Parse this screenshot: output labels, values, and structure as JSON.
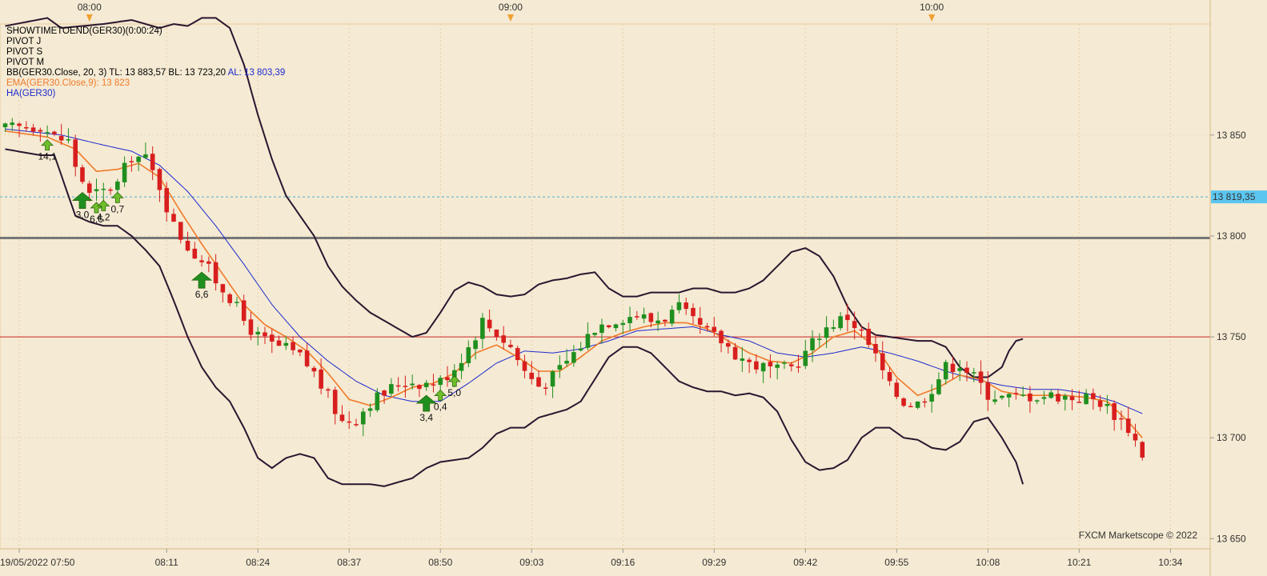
{
  "chart_data": {
    "type": "candlestick",
    "instrument": "GER30",
    "ylim": [
      13645,
      13905
    ],
    "y_ticks": [
      13650,
      13700,
      13750,
      13800,
      13850
    ],
    "y_tick_labels": [
      "13 650",
      "13 700",
      "13 750",
      "13 800",
      "13 850"
    ],
    "current_price": 13819.35,
    "current_price_label": "13 819,35",
    "top_time_labels": [
      {
        "t": 12,
        "label": "08:00"
      },
      {
        "t": 72,
        "label": "09:00"
      },
      {
        "t": 132,
        "label": "10:00"
      }
    ],
    "x_tick_labels": [
      {
        "t": 2,
        "label": "19/05/2022 07:50"
      },
      {
        "t": 23,
        "label": "08:11"
      },
      {
        "t": 36,
        "label": "08:24"
      },
      {
        "t": 49,
        "label": "08:37"
      },
      {
        "t": 62,
        "label": "08:50"
      },
      {
        "t": 75,
        "label": "09:03"
      },
      {
        "t": 88,
        "label": "09:16"
      },
      {
        "t": 101,
        "label": "09:29"
      },
      {
        "t": 114,
        "label": "09:42"
      },
      {
        "t": 127,
        "label": "09:55"
      },
      {
        "t": 140,
        "label": "10:08"
      },
      {
        "t": 153,
        "label": "10:21"
      },
      {
        "t": 166,
        "label": "10:34"
      }
    ],
    "horizontal_lines": [
      {
        "name": "pivot-gray",
        "value": 13799,
        "color": "#777777"
      },
      {
        "name": "pivot-red",
        "value": 13750,
        "color": "#cc2222"
      },
      {
        "name": "current-dotted",
        "value": 13819.35,
        "color": "#4ab0d6"
      }
    ],
    "candle_anchors": [
      [
        0,
        13853
      ],
      [
        3,
        13854
      ],
      [
        5,
        13855
      ],
      [
        7,
        13849
      ],
      [
        9,
        13847
      ],
      [
        10,
        13835
      ],
      [
        12,
        13820
      ],
      [
        14,
        13822
      ],
      [
        16,
        13826
      ],
      [
        18,
        13840
      ],
      [
        20,
        13838
      ],
      [
        22,
        13825
      ],
      [
        24,
        13805
      ],
      [
        26,
        13795
      ],
      [
        28,
        13788
      ],
      [
        30,
        13778
      ],
      [
        32,
        13770
      ],
      [
        34,
        13758
      ],
      [
        36,
        13750
      ],
      [
        38,
        13746
      ],
      [
        40,
        13744
      ],
      [
        42,
        13740
      ],
      [
        44,
        13732
      ],
      [
        46,
        13720
      ],
      [
        48,
        13708
      ],
      [
        50,
        13710
      ],
      [
        52,
        13718
      ],
      [
        54,
        13722
      ],
      [
        56,
        13727
      ],
      [
        58,
        13728
      ],
      [
        60,
        13727
      ],
      [
        62,
        13728
      ],
      [
        64,
        13735
      ],
      [
        66,
        13745
      ],
      [
        68,
        13758
      ],
      [
        70,
        13752
      ],
      [
        72,
        13745
      ],
      [
        74,
        13733
      ],
      [
        76,
        13726
      ],
      [
        78,
        13730
      ],
      [
        80,
        13738
      ],
      [
        82,
        13746
      ],
      [
        84,
        13755
      ],
      [
        86,
        13758
      ],
      [
        88,
        13760
      ],
      [
        90,
        13761
      ],
      [
        92,
        13758
      ],
      [
        94,
        13760
      ],
      [
        96,
        13764
      ],
      [
        98,
        13757
      ],
      [
        100,
        13752
      ],
      [
        102,
        13748
      ],
      [
        104,
        13742
      ],
      [
        106,
        13737
      ],
      [
        108,
        13735
      ],
      [
        110,
        13733
      ],
      [
        112,
        13735
      ],
      [
        114,
        13742
      ],
      [
        116,
        13752
      ],
      [
        118,
        13757
      ],
      [
        120,
        13760
      ],
      [
        122,
        13752
      ],
      [
        124,
        13740
      ],
      [
        126,
        13725
      ],
      [
        128,
        13718
      ],
      [
        130,
        13717
      ],
      [
        132,
        13725
      ],
      [
        134,
        13735
      ],
      [
        136,
        13737
      ],
      [
        138,
        13730
      ],
      [
        140,
        13722
      ],
      [
        142,
        13720
      ],
      [
        144,
        13720
      ],
      [
        146,
        13721
      ],
      [
        148,
        13721
      ],
      [
        150,
        13721
      ],
      [
        152,
        13720
      ],
      [
        154,
        13720
      ],
      [
        156,
        13718
      ],
      [
        158,
        13712
      ],
      [
        160,
        13705
      ],
      [
        162,
        13692
      ]
    ],
    "ema_anchors": [
      [
        0,
        13852
      ],
      [
        6,
        13849
      ],
      [
        10,
        13843
      ],
      [
        13,
        13832
      ],
      [
        16,
        13833
      ],
      [
        19,
        13836
      ],
      [
        22,
        13829
      ],
      [
        25,
        13812
      ],
      [
        28,
        13796
      ],
      [
        31,
        13781
      ],
      [
        34,
        13766
      ],
      [
        37,
        13756
      ],
      [
        40,
        13750
      ],
      [
        43,
        13743
      ],
      [
        46,
        13732
      ],
      [
        49,
        13719
      ],
      [
        52,
        13716
      ],
      [
        55,
        13720
      ],
      [
        58,
        13725
      ],
      [
        61,
        13727
      ],
      [
        64,
        13732
      ],
      [
        67,
        13742
      ],
      [
        70,
        13746
      ],
      [
        73,
        13740
      ],
      [
        76,
        13733
      ],
      [
        79,
        13733
      ],
      [
        82,
        13740
      ],
      [
        85,
        13748
      ],
      [
        88,
        13752
      ],
      [
        91,
        13755
      ],
      [
        94,
        13757
      ],
      [
        97,
        13757
      ],
      [
        100,
        13754
      ],
      [
        103,
        13748
      ],
      [
        106,
        13742
      ],
      [
        109,
        13738
      ],
      [
        112,
        13737
      ],
      [
        115,
        13742
      ],
      [
        118,
        13750
      ],
      [
        121,
        13753
      ],
      [
        124,
        13745
      ],
      [
        127,
        13730
      ],
      [
        130,
        13721
      ],
      [
        133,
        13725
      ],
      [
        136,
        13731
      ],
      [
        139,
        13729
      ],
      [
        142,
        13723
      ],
      [
        145,
        13721
      ],
      [
        148,
        13721
      ],
      [
        151,
        13721
      ],
      [
        154,
        13720
      ],
      [
        157,
        13718
      ],
      [
        160,
        13708
      ],
      [
        162,
        13700
      ]
    ],
    "ha_anchors": [
      [
        0,
        13853
      ],
      [
        8,
        13850
      ],
      [
        14,
        13845
      ],
      [
        18,
        13842
      ],
      [
        22,
        13835
      ],
      [
        26,
        13822
      ],
      [
        30,
        13805
      ],
      [
        34,
        13786
      ],
      [
        38,
        13766
      ],
      [
        42,
        13750
      ],
      [
        46,
        13738
      ],
      [
        50,
        13728
      ],
      [
        54,
        13721
      ],
      [
        58,
        13718
      ],
      [
        62,
        13718
      ],
      [
        66,
        13727
      ],
      [
        70,
        13737
      ],
      [
        74,
        13743
      ],
      [
        78,
        13742
      ],
      [
        82,
        13744
      ],
      [
        86,
        13748
      ],
      [
        90,
        13753
      ],
      [
        94,
        13754
      ],
      [
        98,
        13755
      ],
      [
        102,
        13751
      ],
      [
        106,
        13748
      ],
      [
        110,
        13742
      ],
      [
        114,
        13740
      ],
      [
        118,
        13742
      ],
      [
        122,
        13745
      ],
      [
        126,
        13742
      ],
      [
        130,
        13738
      ],
      [
        134,
        13733
      ],
      [
        138,
        13729
      ],
      [
        142,
        13726
      ],
      [
        146,
        13724
      ],
      [
        150,
        13724
      ],
      [
        154,
        13722
      ],
      [
        158,
        13718
      ],
      [
        162,
        13712
      ]
    ],
    "bb_upper_anchors": [
      [
        0,
        13904
      ],
      [
        6,
        13908
      ],
      [
        8,
        13903
      ],
      [
        14,
        13905
      ],
      [
        18,
        13907
      ],
      [
        20,
        13905
      ],
      [
        22,
        13903
      ],
      [
        24,
        13905
      ],
      [
        26,
        13904
      ],
      [
        28,
        13908
      ],
      [
        30,
        13908
      ],
      [
        32,
        13903
      ],
      [
        34,
        13885
      ],
      [
        36,
        13860
      ],
      [
        38,
        13838
      ],
      [
        40,
        13820
      ],
      [
        42,
        13810
      ],
      [
        44,
        13800
      ],
      [
        46,
        13785
      ],
      [
        48,
        13775
      ],
      [
        50,
        13768
      ],
      [
        52,
        13762
      ],
      [
        54,
        13758
      ],
      [
        56,
        13754
      ],
      [
        58,
        13750
      ],
      [
        60,
        13752
      ],
      [
        62,
        13762
      ],
      [
        64,
        13773
      ],
      [
        66,
        13777
      ],
      [
        68,
        13775
      ],
      [
        70,
        13771
      ],
      [
        72,
        13770
      ],
      [
        74,
        13771
      ],
      [
        76,
        13776
      ],
      [
        78,
        13778
      ],
      [
        80,
        13779
      ],
      [
        82,
        13781
      ],
      [
        84,
        13782
      ],
      [
        86,
        13774
      ],
      [
        88,
        13770
      ],
      [
        90,
        13770
      ],
      [
        92,
        13772
      ],
      [
        94,
        13772
      ],
      [
        96,
        13772
      ],
      [
        98,
        13774
      ],
      [
        100,
        13774
      ],
      [
        102,
        13772
      ],
      [
        104,
        13772
      ],
      [
        106,
        13774
      ],
      [
        108,
        13778
      ],
      [
        110,
        13785
      ],
      [
        112,
        13792
      ],
      [
        114,
        13794
      ],
      [
        116,
        13790
      ],
      [
        118,
        13780
      ],
      [
        120,
        13765
      ],
      [
        122,
        13755
      ],
      [
        124,
        13751
      ],
      [
        126,
        13750
      ],
      [
        128,
        13749
      ],
      [
        130,
        13748
      ],
      [
        132,
        13748
      ],
      [
        134,
        13745
      ],
      [
        136,
        13735
      ],
      [
        138,
        13730
      ],
      [
        140,
        13730
      ],
      [
        142,
        13735
      ],
      [
        143,
        13743
      ],
      [
        144,
        13748
      ],
      [
        145,
        13749
      ]
    ],
    "bb_lower_anchors": [
      [
        0,
        13843
      ],
      [
        5,
        13840
      ],
      [
        7,
        13840
      ],
      [
        8,
        13830
      ],
      [
        10,
        13810
      ],
      [
        12,
        13807
      ],
      [
        14,
        13805
      ],
      [
        16,
        13805
      ],
      [
        18,
        13800
      ],
      [
        20,
        13793
      ],
      [
        22,
        13785
      ],
      [
        24,
        13768
      ],
      [
        26,
        13750
      ],
      [
        28,
        13735
      ],
      [
        30,
        13725
      ],
      [
        32,
        13718
      ],
      [
        34,
        13705
      ],
      [
        36,
        13690
      ],
      [
        38,
        13685
      ],
      [
        40,
        13690
      ],
      [
        42,
        13692
      ],
      [
        44,
        13690
      ],
      [
        46,
        13680
      ],
      [
        48,
        13677
      ],
      [
        50,
        13677
      ],
      [
        52,
        13677
      ],
      [
        54,
        13676
      ],
      [
        56,
        13678
      ],
      [
        58,
        13680
      ],
      [
        60,
        13685
      ],
      [
        62,
        13688
      ],
      [
        64,
        13689
      ],
      [
        66,
        13690
      ],
      [
        68,
        13695
      ],
      [
        70,
        13702
      ],
      [
        72,
        13705
      ],
      [
        74,
        13705
      ],
      [
        76,
        13710
      ],
      [
        78,
        13712
      ],
      [
        80,
        13714
      ],
      [
        82,
        13718
      ],
      [
        84,
        13729
      ],
      [
        86,
        13740
      ],
      [
        88,
        13745
      ],
      [
        90,
        13745
      ],
      [
        92,
        13742
      ],
      [
        94,
        13735
      ],
      [
        96,
        13728
      ],
      [
        98,
        13725
      ],
      [
        100,
        13723
      ],
      [
        102,
        13723
      ],
      [
        104,
        13721
      ],
      [
        106,
        13722
      ],
      [
        108,
        13720
      ],
      [
        110,
        13713
      ],
      [
        112,
        13699
      ],
      [
        114,
        13688
      ],
      [
        116,
        13684
      ],
      [
        118,
        13685
      ],
      [
        120,
        13689
      ],
      [
        122,
        13700
      ],
      [
        124,
        13705
      ],
      [
        126,
        13705
      ],
      [
        128,
        13700
      ],
      [
        130,
        13699
      ],
      [
        132,
        13695
      ],
      [
        134,
        13694
      ],
      [
        136,
        13698
      ],
      [
        138,
        13708
      ],
      [
        140,
        13710
      ],
      [
        142,
        13700
      ],
      [
        144,
        13688
      ],
      [
        145,
        13677
      ]
    ],
    "signals": [
      {
        "t": 6,
        "dir": "up",
        "size": "s",
        "label": "14,1"
      },
      {
        "t": 11,
        "dir": "up",
        "size": "l",
        "label": "3,0"
      },
      {
        "t": 13,
        "dir": "up",
        "size": "s",
        "label": "6,6"
      },
      {
        "t": 14,
        "dir": "up",
        "size": "s",
        "label": "4,2"
      },
      {
        "t": 16,
        "dir": "up",
        "size": "s",
        "label": "0,7"
      },
      {
        "t": 28,
        "dir": "up",
        "size": "l",
        "label": "6,6"
      },
      {
        "t": 60,
        "dir": "up",
        "size": "l",
        "label": "3,4"
      },
      {
        "t": 62,
        "dir": "up",
        "size": "s",
        "label": "0,4"
      },
      {
        "t": 64,
        "dir": "up",
        "size": "s",
        "label": "5,0"
      }
    ],
    "indicator_legend": [
      {
        "text": "SHOWTIMETOEND(GER30)(0:00:24)",
        "color": "#000000"
      },
      {
        "text": "PIVOT J",
        "color": "#000000"
      },
      {
        "text": "PIVOT S",
        "color": "#000000"
      },
      {
        "text": "PIVOT M",
        "color": "#000000"
      },
      {
        "text": "BB(GER30.Close, 20, 3)  TL: 13 883,57   BL: 13 723,20   ",
        "color": "#000000"
      },
      {
        "text": "AL: 13 803,39",
        "color": "#1c2ad0"
      },
      {
        "text": "EMA(GER30.Close,9): 13 823",
        "color": "#f07a2a"
      },
      {
        "text": "HA(GER30)",
        "color": "#1c2ad0"
      }
    ],
    "colors": {
      "background": "#f5ead3",
      "bull": "#1f8f1f",
      "bear": "#d81e1e",
      "bollinger": "#2a1630",
      "ema": "#f07a2a",
      "ha": "#1c2ad0",
      "price_box": "#5bc6ef",
      "marker": "#f0a030"
    },
    "watermark": "FXCM Marketscope © 2022"
  }
}
